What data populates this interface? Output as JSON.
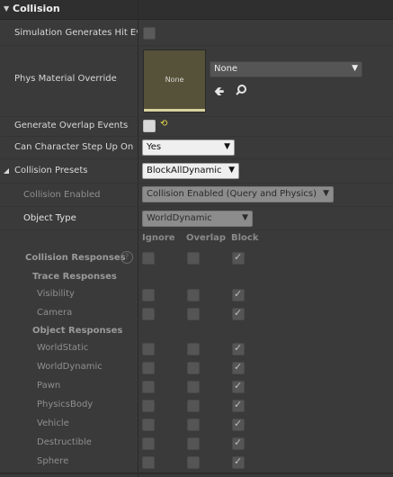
{
  "section": {
    "title": "Collision",
    "expand_icon": "triangle-down"
  },
  "simulation_hit_events": {
    "label": "Simulation Generates Hit Ev"
  },
  "phys_material": {
    "label": "Phys Material Override",
    "thumbnail_text": "None",
    "dropdown_value": "None",
    "use_icon": "arrow-left-icon",
    "browse_icon": "search-icon"
  },
  "overlap_events": {
    "label": "Generate Overlap Events",
    "reset_icon": "reset-arrow-icon"
  },
  "step_up": {
    "label": "Can Character Step Up On",
    "value": "Yes"
  },
  "presets": {
    "label": "Collision Presets",
    "value": "BlockAllDynamic"
  },
  "collision_enabled": {
    "label": "Collision Enabled",
    "value": "Collision Enabled (Query and Physics)"
  },
  "object_type": {
    "label": "Object Type",
    "value": "WorldDynamic"
  },
  "columns": [
    "Ignore",
    "Overlap",
    "Block"
  ],
  "collision_responses": {
    "label": "Collision Responses",
    "help_icon": "?"
  },
  "trace_responses": {
    "label": "Trace Responses",
    "items": [
      {
        "label": "Visibility",
        "block": true
      },
      {
        "label": "Camera",
        "block": true
      }
    ]
  },
  "object_responses": {
    "label": "Object Responses",
    "items": [
      {
        "label": "WorldStatic",
        "block": true
      },
      {
        "label": "WorldDynamic",
        "block": true
      },
      {
        "label": "Pawn",
        "block": true
      },
      {
        "label": "PhysicsBody",
        "block": true
      },
      {
        "label": "Vehicle",
        "block": true
      },
      {
        "label": "Destructible",
        "block": true
      },
      {
        "label": "Sphere",
        "block": true
      }
    ]
  },
  "colors": {
    "panel_bg": "#3a3a3a",
    "header_bg": "#2f2f2f",
    "accent_yellow": "#e8d84a"
  }
}
